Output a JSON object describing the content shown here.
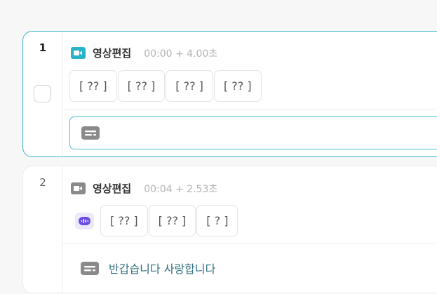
{
  "clips": [
    {
      "index": "1",
      "title": "영상편집",
      "time": "00:00 + 4.00초",
      "tokens": [
        "[ ?? ]",
        "[ ?? ]",
        "[ ?? ]",
        "[ ?? ]"
      ],
      "subtitle": ""
    },
    {
      "index": "2",
      "title": "영상편집",
      "time": "00:04 + 2.53초",
      "tokens": [
        "[ ?? ]",
        "[ ?? ]",
        "[ ? ]"
      ],
      "subtitle": "반갑습니다 사랑합니다"
    }
  ],
  "colors": {
    "accent": "#3fb6c6",
    "video_icon_active": "#2ab3c8",
    "video_icon_inactive": "#8a8a8a",
    "voice_icon": "#6b4de6",
    "subtitle_text": "#2f6f7e"
  }
}
